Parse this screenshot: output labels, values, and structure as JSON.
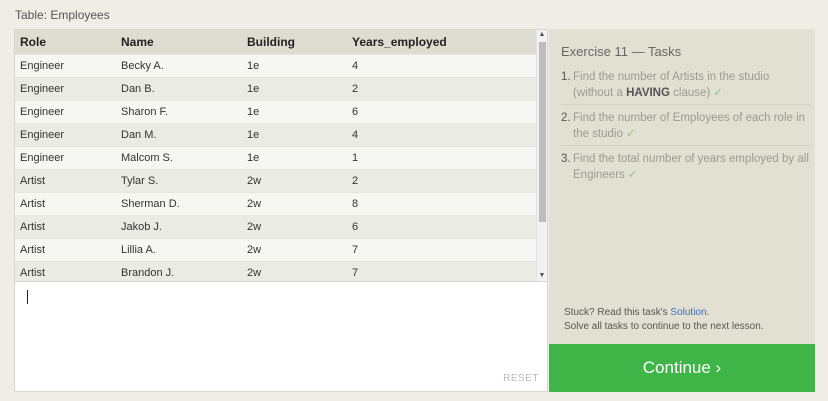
{
  "table": {
    "caption": "Table: Employees",
    "columns": [
      "Role",
      "Name",
      "Building",
      "Years_employed"
    ],
    "rows": [
      [
        "Engineer",
        "Becky A.",
        "1e",
        "4"
      ],
      [
        "Engineer",
        "Dan B.",
        "1e",
        "2"
      ],
      [
        "Engineer",
        "Sharon F.",
        "1e",
        "6"
      ],
      [
        "Engineer",
        "Dan M.",
        "1e",
        "4"
      ],
      [
        "Engineer",
        "Malcom S.",
        "1e",
        "1"
      ],
      [
        "Artist",
        "Tylar S.",
        "2w",
        "2"
      ],
      [
        "Artist",
        "Sherman D.",
        "2w",
        "8"
      ],
      [
        "Artist",
        "Jakob J.",
        "2w",
        "6"
      ],
      [
        "Artist",
        "Lillia A.",
        "2w",
        "7"
      ],
      [
        "Artist",
        "Brandon J.",
        "2w",
        "7"
      ]
    ]
  },
  "editor": {
    "value": "",
    "reset_label": "RESET"
  },
  "tasks": {
    "title": "Exercise 11 — Tasks",
    "items": [
      {
        "num": "1.",
        "text_before": "Find the number of Artists in the studio (without a ",
        "bold": "HAVING",
        "text_after": " clause)",
        "check": "✓"
      },
      {
        "num": "2.",
        "text_before": "Find the number of Employees of each role in the studio",
        "bold": "",
        "text_after": "",
        "check": "✓"
      },
      {
        "num": "3.",
        "text_before": "Find the total number of years employed by all Engineers",
        "bold": "",
        "text_after": "",
        "check": "✓"
      }
    ],
    "stuck_prefix": "Stuck? Read this task's ",
    "solution_link": "Solution",
    "stuck_suffix": ".",
    "continue_note": "Solve all tasks to continue to the next lesson."
  },
  "continue_button": {
    "label": "Continue ›"
  },
  "colors": {
    "accent": "#3fb548",
    "panel": "#e2e0d3",
    "link": "#3a6fc2"
  }
}
